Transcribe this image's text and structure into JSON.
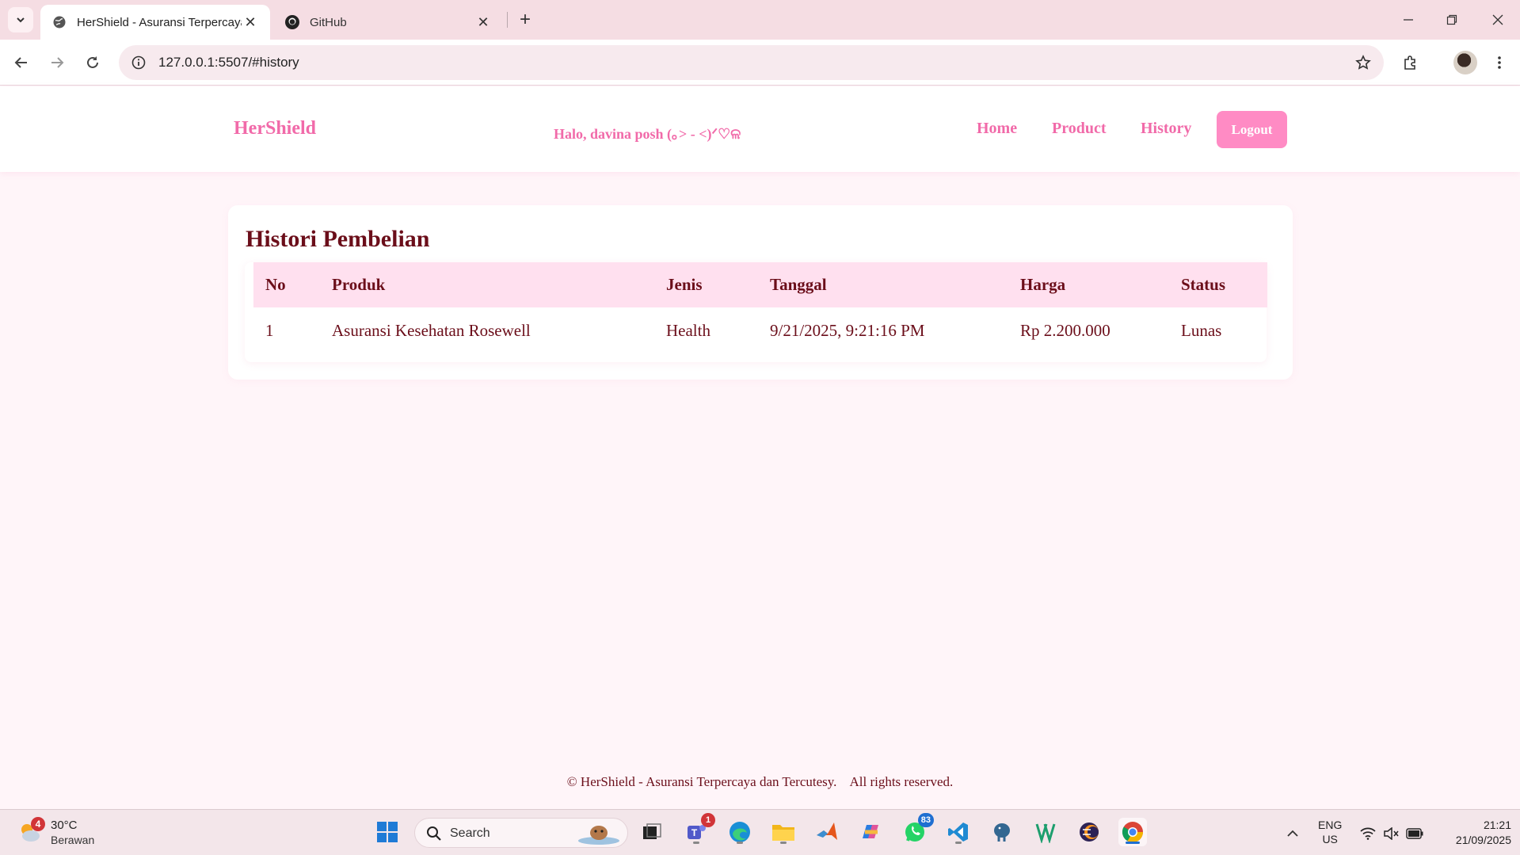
{
  "browser": {
    "tabs": [
      {
        "title": "HerShield - Asuransi Terpercaya",
        "active": true
      },
      {
        "title": "GitHub",
        "active": false
      }
    ],
    "url": "127.0.0.1:5507/#history"
  },
  "header": {
    "brand": "HerShield",
    "greeting": "Halo, davina posh (｡> - <)ᐟ♡ଳ",
    "nav": [
      "Home",
      "Product",
      "History"
    ],
    "logout_label": "Logout"
  },
  "history": {
    "title": "Histori Pembelian",
    "columns": [
      "No",
      "Produk",
      "Jenis",
      "Tanggal",
      "Harga",
      "Status"
    ],
    "rows": [
      [
        "1",
        "Asuransi Kesehatan Rosewell",
        "Health",
        "9/21/2025, 9:21:16 PM",
        "Rp 2.200.000",
        "Lunas"
      ]
    ]
  },
  "footer": {
    "text": "© HerShield - Asuransi Terpercaya dan Tercutesy.    All rights reserved."
  },
  "taskbar": {
    "weather": {
      "temp": "30°C",
      "desc": "Berawan",
      "badge": "4"
    },
    "search_label": "Search",
    "teams_badge": "1",
    "whatsapp_badge": "83",
    "lang_top": "ENG",
    "lang_bottom": "US",
    "time": "21:21",
    "date": "21/09/2025"
  },
  "colors": {
    "brand_pink": "#f16aa9",
    "button_pink": "#ff8bc4",
    "table_header": "#ffe0ef",
    "text_maroon": "#6b0e1a",
    "page_bg": "#fff5f9"
  }
}
